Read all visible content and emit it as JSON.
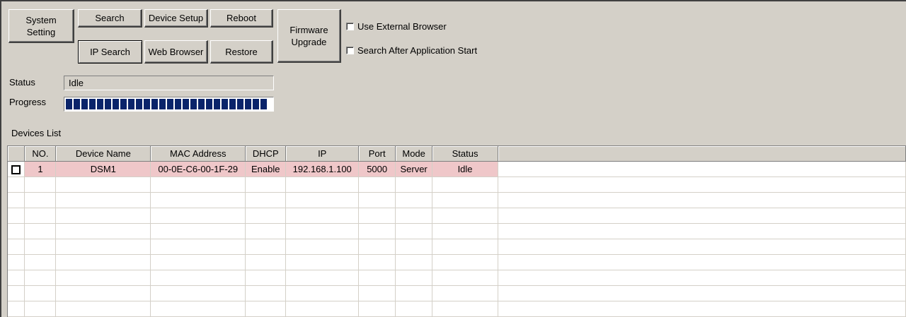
{
  "toolbar": {
    "system_setting": "System\nSetting",
    "search": "Search",
    "ip_search": "IP Search",
    "device_setup": "Device Setup",
    "web_browser": "Web Browser",
    "reboot": "Reboot",
    "restore": "Restore",
    "firmware_upgrade": "Firmware\nUpgrade"
  },
  "options": {
    "use_external_browser": {
      "label": "Use External Browser",
      "checked": false
    },
    "search_after_start": {
      "label": "Search After Application Start",
      "checked": false
    }
  },
  "status": {
    "label": "Status",
    "value": "Idle"
  },
  "progress": {
    "label": "Progress",
    "percent": 100,
    "bar_color": "#0a246a"
  },
  "devices": {
    "label": "Devices List",
    "columns": [
      "",
      "NO.",
      "Device Name",
      "MAC Address",
      "DHCP",
      "IP",
      "Port",
      "Mode",
      "Status",
      ""
    ],
    "rows": [
      {
        "checked": false,
        "no": "1",
        "device_name": "DSM1",
        "mac": "00-0E-C6-00-1F-29",
        "dhcp": "Enable",
        "ip": "192.168.1.100",
        "port": "5000",
        "mode": "Server",
        "status": "Idle"
      }
    ],
    "highlight_color": "#efc7c9"
  }
}
